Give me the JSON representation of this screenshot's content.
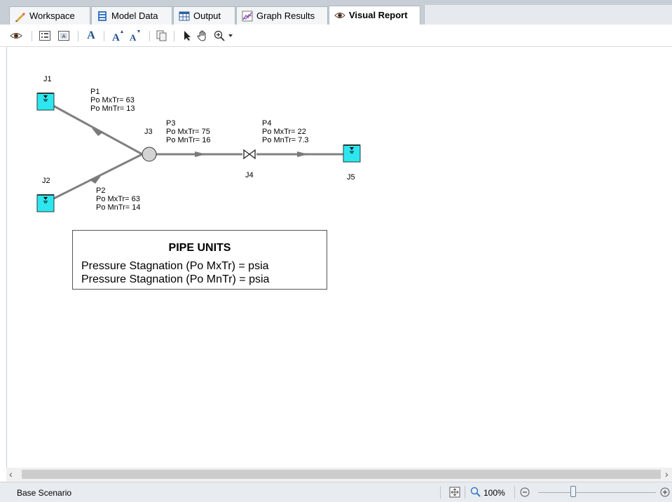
{
  "tabs": [
    {
      "label": "Workspace",
      "icon": "pencil-icon"
    },
    {
      "label": "Model Data",
      "icon": "model-data-icon"
    },
    {
      "label": "Output",
      "icon": "table-icon"
    },
    {
      "label": "Graph Results",
      "icon": "graph-icon"
    },
    {
      "label": "Visual Report",
      "icon": "eye-icon",
      "active": true
    }
  ],
  "toolbar": {
    "font_a": "A",
    "icons": [
      "eye-icon",
      "list-icon",
      "label-icon",
      "font-icon",
      "font-increase-icon",
      "font-decrease-icon",
      "copy-icon",
      "pointer-icon",
      "pan-hand-icon",
      "zoom-in-icon",
      "dropdown-arrow-icon"
    ]
  },
  "junctions": {
    "J1": {
      "label": "J1",
      "type": "reservoir"
    },
    "J2": {
      "label": "J2",
      "type": "reservoir"
    },
    "J3": {
      "label": "J3",
      "type": "branch"
    },
    "J4": {
      "label": "J4",
      "type": "valve"
    },
    "J5": {
      "label": "J5",
      "type": "reservoir"
    }
  },
  "pipes": {
    "P1": {
      "name": "P1",
      "max": "Po MxTr= 63",
      "min": "Po MnTr= 13"
    },
    "P2": {
      "name": "P2",
      "max": "Po MxTr= 63",
      "min": "Po MnTr= 14"
    },
    "P3": {
      "name": "P3",
      "max": "Po MxTr= 75",
      "min": "Po MnTr= 16"
    },
    "P4": {
      "name": "P4",
      "max": "Po MxTr= 22",
      "min": "Po MnTr= 7.3"
    }
  },
  "legend": {
    "title": "PIPE UNITS",
    "line1": "Pressure Stagnation  (Po  MxTr) = psia",
    "line2": "Pressure Stagnation  (Po  MnTr) = psia"
  },
  "status": {
    "scenario": "Base Scenario",
    "zoom": "100%"
  },
  "colors": {
    "reservoir_fill": "#2ee6ee",
    "pipe": "#808080",
    "tabbar": "#c8ced6"
  }
}
